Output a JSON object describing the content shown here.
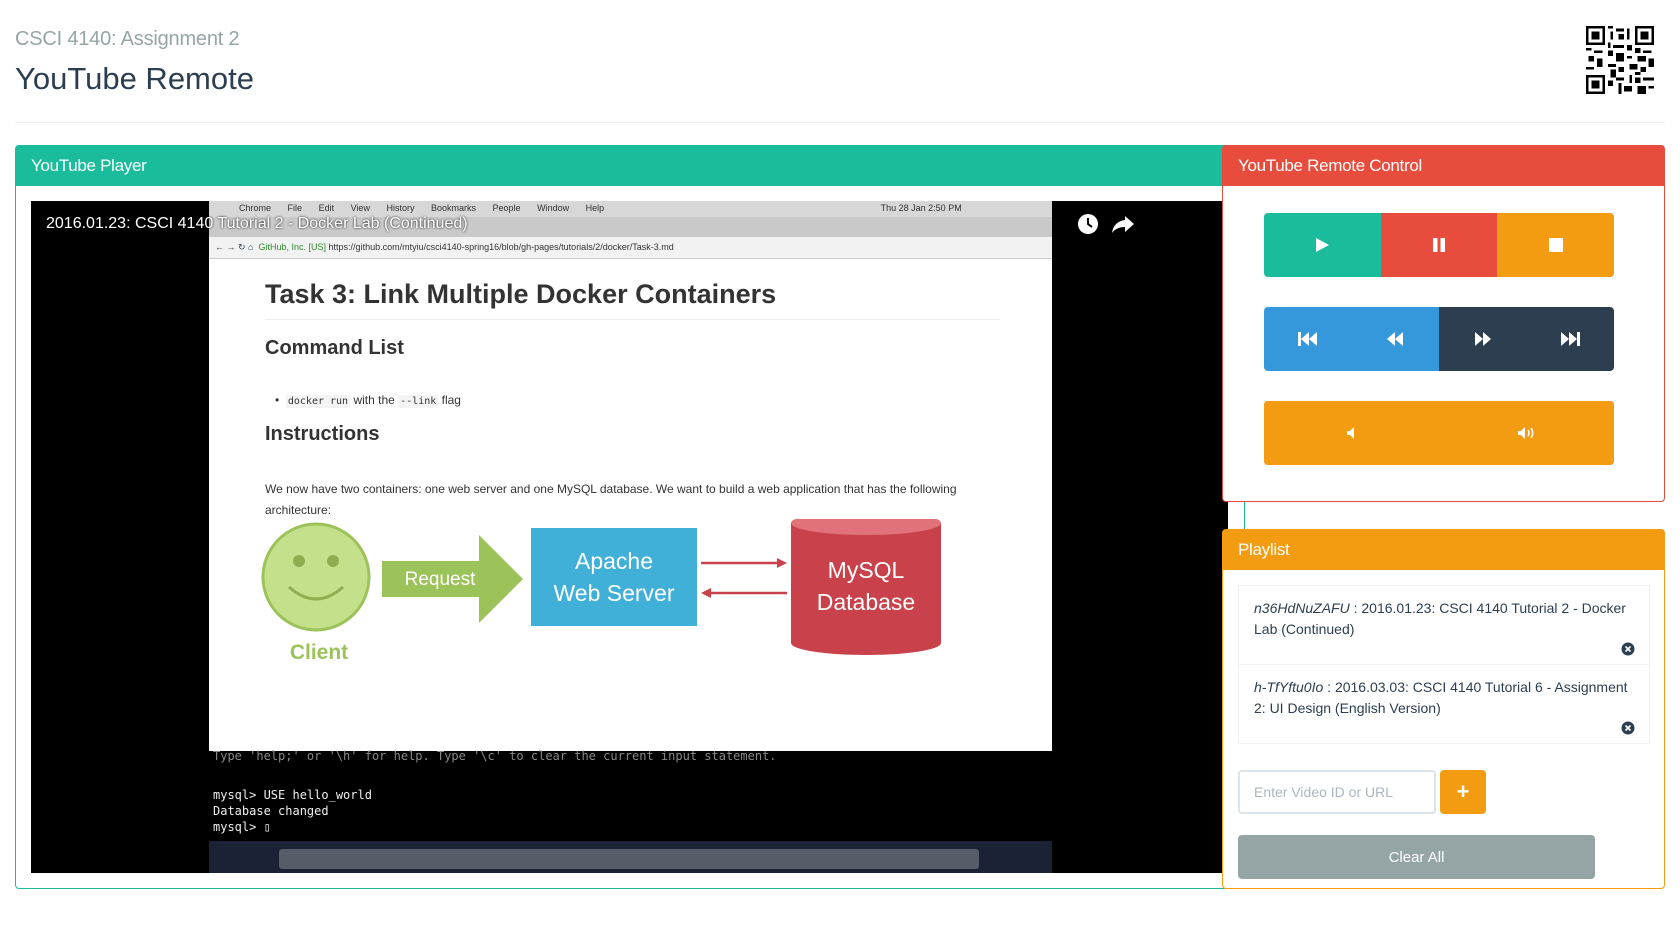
{
  "header": {
    "subtitle": "CSCI 4140: Assignment 2",
    "title": "YouTube Remote"
  },
  "player": {
    "heading": "YouTube Player",
    "video_title": "2016.01.23: CSCI 4140 Tutorial 2 - Docker Lab (Continued)",
    "screen": {
      "menubar": [
        "Chrome",
        "File",
        "Edit",
        "View",
        "History",
        "Bookmarks",
        "People",
        "Window",
        "Help"
      ],
      "clock": "Thu 28 Jan  2:50 PM",
      "secure_label": "GitHub, Inc. [US]",
      "url": "https://github.com/mtyiu/csci4140-spring16/blob/gh-pages/tutorials/2/docker/Task-3.md",
      "doc_title": "Task 3: Link Multiple Docker Containers",
      "section1": "Command List",
      "bullet_code1": "docker run",
      "bullet_text": "with the",
      "bullet_code2": "--link",
      "bullet_end": "flag",
      "section2": "Instructions",
      "paragraph": "We now have two containers: one web server and one MySQL database. We want to build a web application that has the following architecture:",
      "diagram": {
        "client": "Client",
        "request": "Request",
        "server_line1": "Apache",
        "server_line2": "Web Server",
        "db_line1": "MySQL",
        "db_line2": "Database"
      },
      "terminal": [
        "Type 'help;' or '\\h' for help. Type '\\c' to clear the current input statement.",
        "",
        "mysql> USE hello_world",
        "Database changed",
        "mysql> ▯"
      ]
    }
  },
  "remote": {
    "heading": "YouTube Remote Control",
    "colors": {
      "play": "#1abc9c",
      "pause": "#e74c3c",
      "stop": "#f39c12",
      "prev": "#3498db",
      "rewind": "#3498db",
      "forward": "#2c3e50",
      "next": "#2c3e50",
      "volume": "#f39c12"
    },
    "icons": [
      "play-icon",
      "pause-icon",
      "stop-icon",
      "skip-back-icon",
      "rewind-icon",
      "fast-forward-icon",
      "skip-forward-icon",
      "volume-down-icon",
      "volume-up-icon"
    ]
  },
  "playlist": {
    "heading": "Playlist",
    "items": [
      {
        "id": "n36HdNuZAFU",
        "separator": " : ",
        "title": "2016.01.23: CSCI 4140 Tutorial 2 - Docker Lab (Continued)"
      },
      {
        "id": "h-TfYftu0Io",
        "separator": " : ",
        "title": "2016.03.03: CSCI 4140 Tutorial 6 - Assignment 2: UI Design (English Version)"
      }
    ],
    "input_placeholder": "Enter Video ID or URL",
    "add_label": "+",
    "clear_label": "Clear All"
  }
}
